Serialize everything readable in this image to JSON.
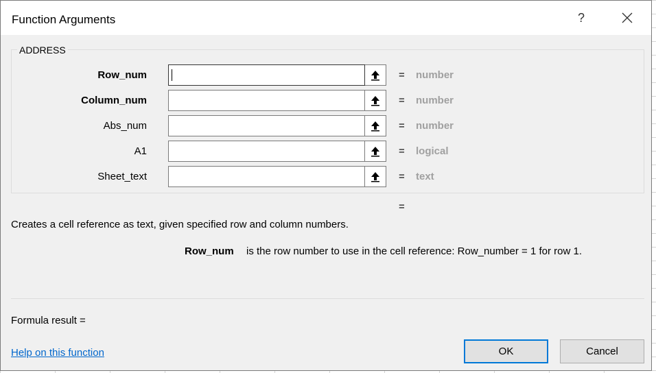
{
  "dialog": {
    "title": "Function Arguments",
    "help_glyph": "?",
    "function_name": "ADDRESS",
    "arguments": [
      {
        "label": "Row_num",
        "value": "",
        "type": "number"
      },
      {
        "label": "Column_num",
        "value": "",
        "type": "number"
      },
      {
        "label": "Abs_num",
        "value": "",
        "type": "number"
      },
      {
        "label": "A1",
        "value": "",
        "type": "logical"
      },
      {
        "label": "Sheet_text",
        "value": "",
        "type": "text"
      }
    ],
    "equals": "=",
    "description": "Creates a cell reference as text, given specified row and column numbers.",
    "arg_help_name": "Row_num",
    "arg_help_text": "is the row number to use in the cell reference: Row_number = 1 for row 1.",
    "formula_result_label": "Formula result =",
    "help_link": "Help on this function",
    "ok_label": "OK",
    "cancel_label": "Cancel"
  },
  "colors": {
    "accent": "#0078d7",
    "link": "#0066cc",
    "type_hint": "#a0a0a0"
  }
}
